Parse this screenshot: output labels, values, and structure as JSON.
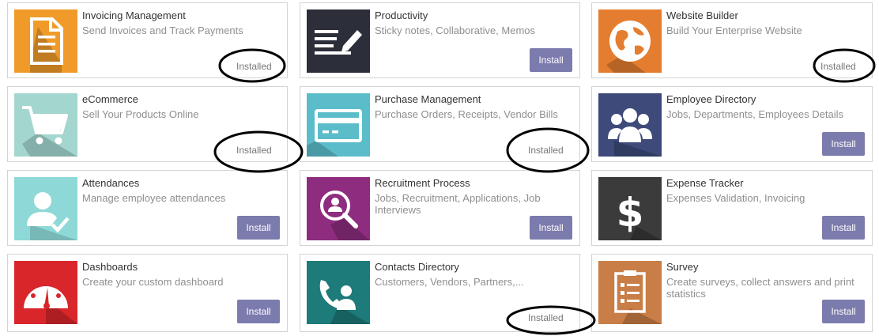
{
  "apps": [
    {
      "name": "Invoicing Management",
      "description": "Send Invoices and Track Payments",
      "status": "Installed",
      "icon": "document-icon",
      "color": "#f09b29"
    },
    {
      "name": "Productivity",
      "description": "Sticky notes, Collaborative, Memos",
      "status": "Install",
      "icon": "note-pencil-icon",
      "color": "#2c2f3a"
    },
    {
      "name": "Website Builder",
      "description": "Build Your Enterprise Website",
      "status": "Installed",
      "icon": "globe-icon",
      "color": "#e47d2f"
    },
    {
      "name": "eCommerce",
      "description": "Sell Your Products Online",
      "status": "Installed",
      "icon": "shopping-cart-icon",
      "color": "#a3d6cf"
    },
    {
      "name": "Purchase Management",
      "description": "Purchase Orders, Receipts, Vendor Bills",
      "status": "Installed",
      "icon": "credit-card-icon",
      "color": "#5bbcca"
    },
    {
      "name": "Employee Directory",
      "description": "Jobs, Departments, Employees Details",
      "status": "Install",
      "icon": "users-icon",
      "color": "#3d4a7a"
    },
    {
      "name": "Attendances",
      "description": "Manage employee attendances",
      "status": "Install",
      "icon": "user-check-icon",
      "color": "#8ed9d8"
    },
    {
      "name": "Recruitment Process",
      "description": "Jobs, Recruitment, Applications, Job Interviews",
      "status": "Install",
      "icon": "search-user-icon",
      "color": "#8e2d7f"
    },
    {
      "name": "Expense Tracker",
      "description": "Expenses Validation, Invoicing",
      "status": "Install",
      "icon": "dollar-icon",
      "color": "#3b3b3b"
    },
    {
      "name": "Dashboards",
      "description": "Create your custom dashboard",
      "status": "Install",
      "icon": "speedometer-icon",
      "color": "#d9262b"
    },
    {
      "name": "Contacts Directory",
      "description": "Customers, Vendors, Partners,...",
      "status": "Installed",
      "icon": "phone-contact-icon",
      "color": "#1d7b7a"
    },
    {
      "name": "Survey",
      "description": "Create surveys, collect answers and print statistics",
      "status": "Install",
      "icon": "clipboard-list-icon",
      "color": "#c97e47"
    }
  ]
}
